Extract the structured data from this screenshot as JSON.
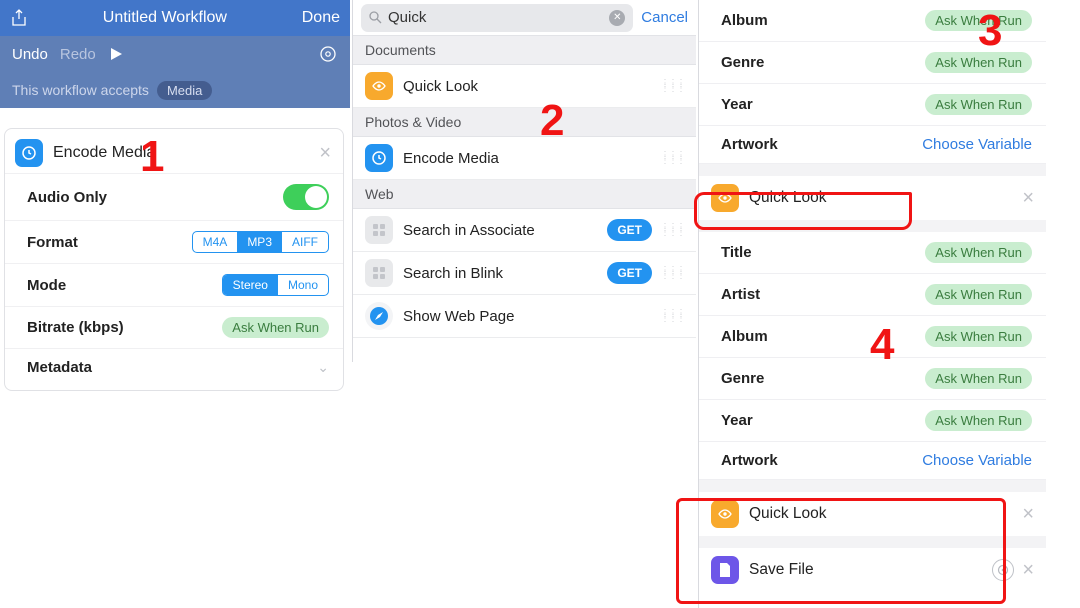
{
  "p1": {
    "title": "Untitled Workflow",
    "done": "Done",
    "undo": "Undo",
    "redo": "Redo",
    "accepts": "This workflow accepts",
    "acceptsTag": "Media",
    "card": {
      "title": "Encode Media",
      "r_audio": "Audio Only",
      "r_format": "Format",
      "format_seg": [
        "M4A",
        "MP3",
        "AIFF"
      ],
      "format_sel": 1,
      "r_mode": "Mode",
      "mode_seg": [
        "Stereo",
        "Mono"
      ],
      "mode_sel": 0,
      "r_bitrate": "Bitrate (kbps)",
      "bitrate_val": "Ask When Run",
      "r_meta": "Metadata"
    }
  },
  "p2": {
    "query": "Quick",
    "cancel": "Cancel",
    "sec_docs": "Documents",
    "item_ql": "Quick Look",
    "sec_pv": "Photos & Video",
    "item_em": "Encode Media",
    "sec_web": "Web",
    "item_sa": "Search in Associate",
    "item_sb": "Search in Blink",
    "get": "GET",
    "item_swp": "Show Web Page"
  },
  "topMeta": {
    "album": "Album",
    "genre": "Genre",
    "year": "Year",
    "artwork": "Artwork",
    "awr": "Ask When Run",
    "cv": "Choose Variable"
  },
  "ql1": "Quick Look",
  "meta4": {
    "title": "Title",
    "artist": "Artist",
    "album": "Album",
    "genre": "Genre",
    "year": "Year",
    "artwork": "Artwork",
    "awr": "Ask When Run",
    "cv": "Choose Variable"
  },
  "ql2": "Quick Look",
  "savefile": "Save File",
  "ann": {
    "a1": "1",
    "a2": "2",
    "a3": "3",
    "a4": "4"
  }
}
